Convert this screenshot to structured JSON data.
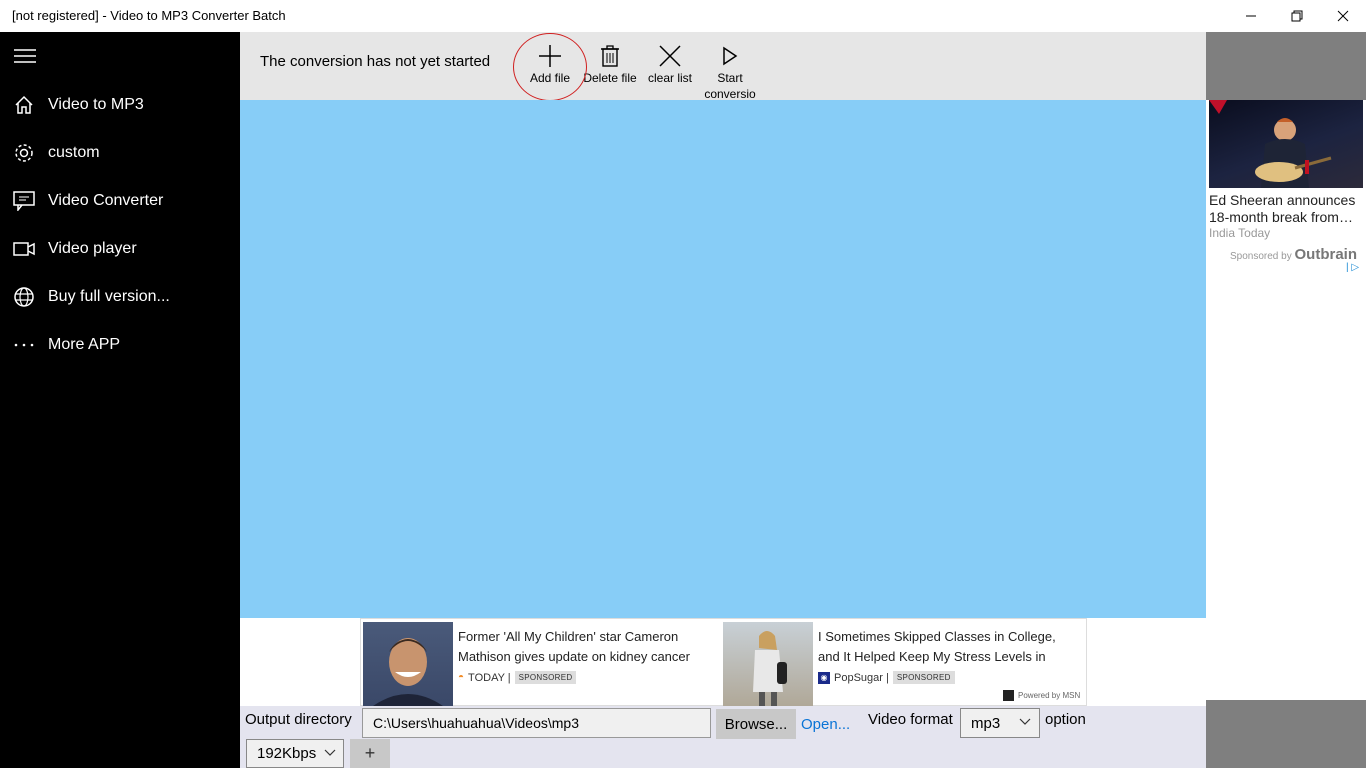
{
  "window": {
    "title": "[not registered] - Video to MP3 Converter Batch"
  },
  "sidebar": {
    "items": [
      {
        "label": "Video to MP3",
        "icon": "home-icon"
      },
      {
        "label": "custom",
        "icon": "gear-icon"
      },
      {
        "label": "Video Converter",
        "icon": "chat-screen-icon"
      },
      {
        "label": "Video player",
        "icon": "video-camera-icon"
      },
      {
        "label": "Buy full version...",
        "icon": "globe-icon"
      },
      {
        "label": "More APP",
        "icon": "more-dots-icon"
      }
    ]
  },
  "toolbar": {
    "status": "The conversion has not yet started",
    "add_file": "Add file",
    "delete_file": "Delete file",
    "clear_list": "clear list",
    "start_conversion": "Start conversio"
  },
  "side_ad": {
    "headline": "Ed Sheeran announces 18-month break from…",
    "source": "India Today",
    "sponsored_by": "Sponsored by",
    "brand": "Outbrain"
  },
  "bottom_ad": {
    "cards": [
      {
        "text": "Former 'All My Children' star Cameron Mathison gives update on kidney cancer",
        "source": "TODAY |",
        "badge": "SPONSORED"
      },
      {
        "text": "I Sometimes Skipped Classes in College, and It Helped Keep My Stress Levels in",
        "source": "PopSugar |",
        "badge": "SPONSORED"
      }
    ],
    "powered_by": "Powered by MSN"
  },
  "bottombar": {
    "output_label": "Output directory",
    "output_path": "C:\\Users\\huahuahua\\Videos\\mp3",
    "browse": "Browse...",
    "open": "Open...",
    "video_format_label": "Video format",
    "video_format": "mp3",
    "option_label": "option",
    "bitrate": "192Kbps",
    "add": "+"
  },
  "colors": {
    "sidebar_bg": "#000000",
    "toolbar_bg": "#e6e6e6",
    "list_bg": "#87cdf7",
    "highlight_circle": "#d02020",
    "link": "#0a74d6"
  }
}
